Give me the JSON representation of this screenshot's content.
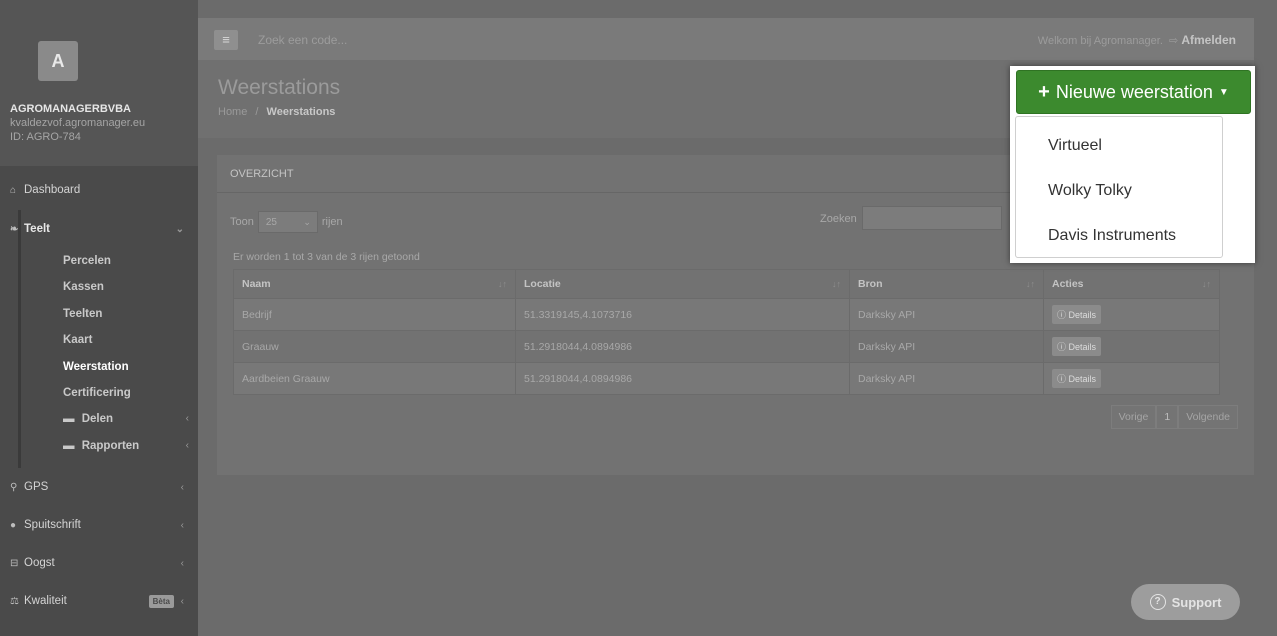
{
  "sidebar": {
    "avatar_letter": "A",
    "company": "AGROMANAGERBVBA",
    "email": "kvaldezvof.agromanager.eu",
    "account_id": "ID: AGRO-784",
    "items": [
      {
        "label": "Dashboard",
        "icon": "home-icon"
      },
      {
        "label": "Teelt",
        "icon": "leaf-icon"
      },
      {
        "label": "GPS",
        "icon": "map-marker-icon"
      },
      {
        "label": "Spuitschrift",
        "icon": "droplet-icon"
      },
      {
        "label": "Oogst",
        "icon": "basket-icon"
      },
      {
        "label": "Kwaliteit",
        "icon": "scale-icon",
        "badge": "Bèta"
      }
    ],
    "sub_items": [
      {
        "label": "Percelen"
      },
      {
        "label": "Kassen"
      },
      {
        "label": "Teelten"
      },
      {
        "label": "Kaart"
      },
      {
        "label": "Weerstation"
      },
      {
        "label": "Certificering"
      },
      {
        "label": "Delen",
        "icon": "folder-icon"
      },
      {
        "label": "Rapporten",
        "icon": "folder-icon"
      }
    ]
  },
  "topbar": {
    "search_placeholder": "Zoek een code...",
    "welcome": "Welkom bij Agromanager.",
    "logout": "Afmelden"
  },
  "header": {
    "title": "Weerstations",
    "breadcrumb_home": "Home",
    "breadcrumb_sep": "/",
    "breadcrumb_current": "Weerstations"
  },
  "panel": {
    "title": "OVERZICHT",
    "show_prefix": "Toon",
    "show_value": "25",
    "show_suffix": "rijen",
    "search_label": "Zoeken",
    "info": "Er worden 1 tot 3 van de 3 rijen getoond",
    "columns": [
      "Naam",
      "Locatie",
      "Bron",
      "Acties"
    ],
    "rows": [
      {
        "naam": "Bedrijf",
        "locatie": "51.3319145,4.1073716",
        "bron": "Darksky API",
        "actie": "Details"
      },
      {
        "naam": "Graauw",
        "locatie": "51.2918044,4.0894986",
        "bron": "Darksky API",
        "actie": "Details"
      },
      {
        "naam": "Aardbeien Graauw",
        "locatie": "51.2918044,4.0894986",
        "bron": "Darksky API",
        "actie": "Details"
      }
    ],
    "pager": {
      "prev": "Vorige",
      "page": "1",
      "next": "Volgende"
    }
  },
  "new_button": {
    "label": "Nieuwe weerstation",
    "color": "#3c8a2e",
    "options": [
      "Virtueel",
      "Wolky Tolky",
      "Davis Instruments"
    ]
  },
  "support": {
    "label": "Support"
  }
}
